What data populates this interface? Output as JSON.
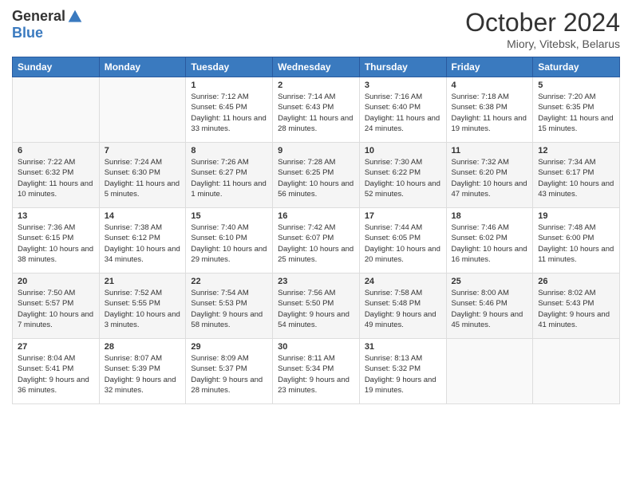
{
  "header": {
    "logo_general": "General",
    "logo_blue": "Blue",
    "month_title": "October 2024",
    "location": "Miory, Vitebsk, Belarus"
  },
  "weekdays": [
    "Sunday",
    "Monday",
    "Tuesday",
    "Wednesday",
    "Thursday",
    "Friday",
    "Saturday"
  ],
  "weeks": [
    [
      {
        "day": "",
        "info": ""
      },
      {
        "day": "",
        "info": ""
      },
      {
        "day": "1",
        "info": "Sunrise: 7:12 AM\nSunset: 6:45 PM\nDaylight: 11 hours and 33 minutes."
      },
      {
        "day": "2",
        "info": "Sunrise: 7:14 AM\nSunset: 6:43 PM\nDaylight: 11 hours and 28 minutes."
      },
      {
        "day": "3",
        "info": "Sunrise: 7:16 AM\nSunset: 6:40 PM\nDaylight: 11 hours and 24 minutes."
      },
      {
        "day": "4",
        "info": "Sunrise: 7:18 AM\nSunset: 6:38 PM\nDaylight: 11 hours and 19 minutes."
      },
      {
        "day": "5",
        "info": "Sunrise: 7:20 AM\nSunset: 6:35 PM\nDaylight: 11 hours and 15 minutes."
      }
    ],
    [
      {
        "day": "6",
        "info": "Sunrise: 7:22 AM\nSunset: 6:32 PM\nDaylight: 11 hours and 10 minutes."
      },
      {
        "day": "7",
        "info": "Sunrise: 7:24 AM\nSunset: 6:30 PM\nDaylight: 11 hours and 5 minutes."
      },
      {
        "day": "8",
        "info": "Sunrise: 7:26 AM\nSunset: 6:27 PM\nDaylight: 11 hours and 1 minute."
      },
      {
        "day": "9",
        "info": "Sunrise: 7:28 AM\nSunset: 6:25 PM\nDaylight: 10 hours and 56 minutes."
      },
      {
        "day": "10",
        "info": "Sunrise: 7:30 AM\nSunset: 6:22 PM\nDaylight: 10 hours and 52 minutes."
      },
      {
        "day": "11",
        "info": "Sunrise: 7:32 AM\nSunset: 6:20 PM\nDaylight: 10 hours and 47 minutes."
      },
      {
        "day": "12",
        "info": "Sunrise: 7:34 AM\nSunset: 6:17 PM\nDaylight: 10 hours and 43 minutes."
      }
    ],
    [
      {
        "day": "13",
        "info": "Sunrise: 7:36 AM\nSunset: 6:15 PM\nDaylight: 10 hours and 38 minutes."
      },
      {
        "day": "14",
        "info": "Sunrise: 7:38 AM\nSunset: 6:12 PM\nDaylight: 10 hours and 34 minutes."
      },
      {
        "day": "15",
        "info": "Sunrise: 7:40 AM\nSunset: 6:10 PM\nDaylight: 10 hours and 29 minutes."
      },
      {
        "day": "16",
        "info": "Sunrise: 7:42 AM\nSunset: 6:07 PM\nDaylight: 10 hours and 25 minutes."
      },
      {
        "day": "17",
        "info": "Sunrise: 7:44 AM\nSunset: 6:05 PM\nDaylight: 10 hours and 20 minutes."
      },
      {
        "day": "18",
        "info": "Sunrise: 7:46 AM\nSunset: 6:02 PM\nDaylight: 10 hours and 16 minutes."
      },
      {
        "day": "19",
        "info": "Sunrise: 7:48 AM\nSunset: 6:00 PM\nDaylight: 10 hours and 11 minutes."
      }
    ],
    [
      {
        "day": "20",
        "info": "Sunrise: 7:50 AM\nSunset: 5:57 PM\nDaylight: 10 hours and 7 minutes."
      },
      {
        "day": "21",
        "info": "Sunrise: 7:52 AM\nSunset: 5:55 PM\nDaylight: 10 hours and 3 minutes."
      },
      {
        "day": "22",
        "info": "Sunrise: 7:54 AM\nSunset: 5:53 PM\nDaylight: 9 hours and 58 minutes."
      },
      {
        "day": "23",
        "info": "Sunrise: 7:56 AM\nSunset: 5:50 PM\nDaylight: 9 hours and 54 minutes."
      },
      {
        "day": "24",
        "info": "Sunrise: 7:58 AM\nSunset: 5:48 PM\nDaylight: 9 hours and 49 minutes."
      },
      {
        "day": "25",
        "info": "Sunrise: 8:00 AM\nSunset: 5:46 PM\nDaylight: 9 hours and 45 minutes."
      },
      {
        "day": "26",
        "info": "Sunrise: 8:02 AM\nSunset: 5:43 PM\nDaylight: 9 hours and 41 minutes."
      }
    ],
    [
      {
        "day": "27",
        "info": "Sunrise: 8:04 AM\nSunset: 5:41 PM\nDaylight: 9 hours and 36 minutes."
      },
      {
        "day": "28",
        "info": "Sunrise: 8:07 AM\nSunset: 5:39 PM\nDaylight: 9 hours and 32 minutes."
      },
      {
        "day": "29",
        "info": "Sunrise: 8:09 AM\nSunset: 5:37 PM\nDaylight: 9 hours and 28 minutes."
      },
      {
        "day": "30",
        "info": "Sunrise: 8:11 AM\nSunset: 5:34 PM\nDaylight: 9 hours and 23 minutes."
      },
      {
        "day": "31",
        "info": "Sunrise: 8:13 AM\nSunset: 5:32 PM\nDaylight: 9 hours and 19 minutes."
      },
      {
        "day": "",
        "info": ""
      },
      {
        "day": "",
        "info": ""
      }
    ]
  ]
}
